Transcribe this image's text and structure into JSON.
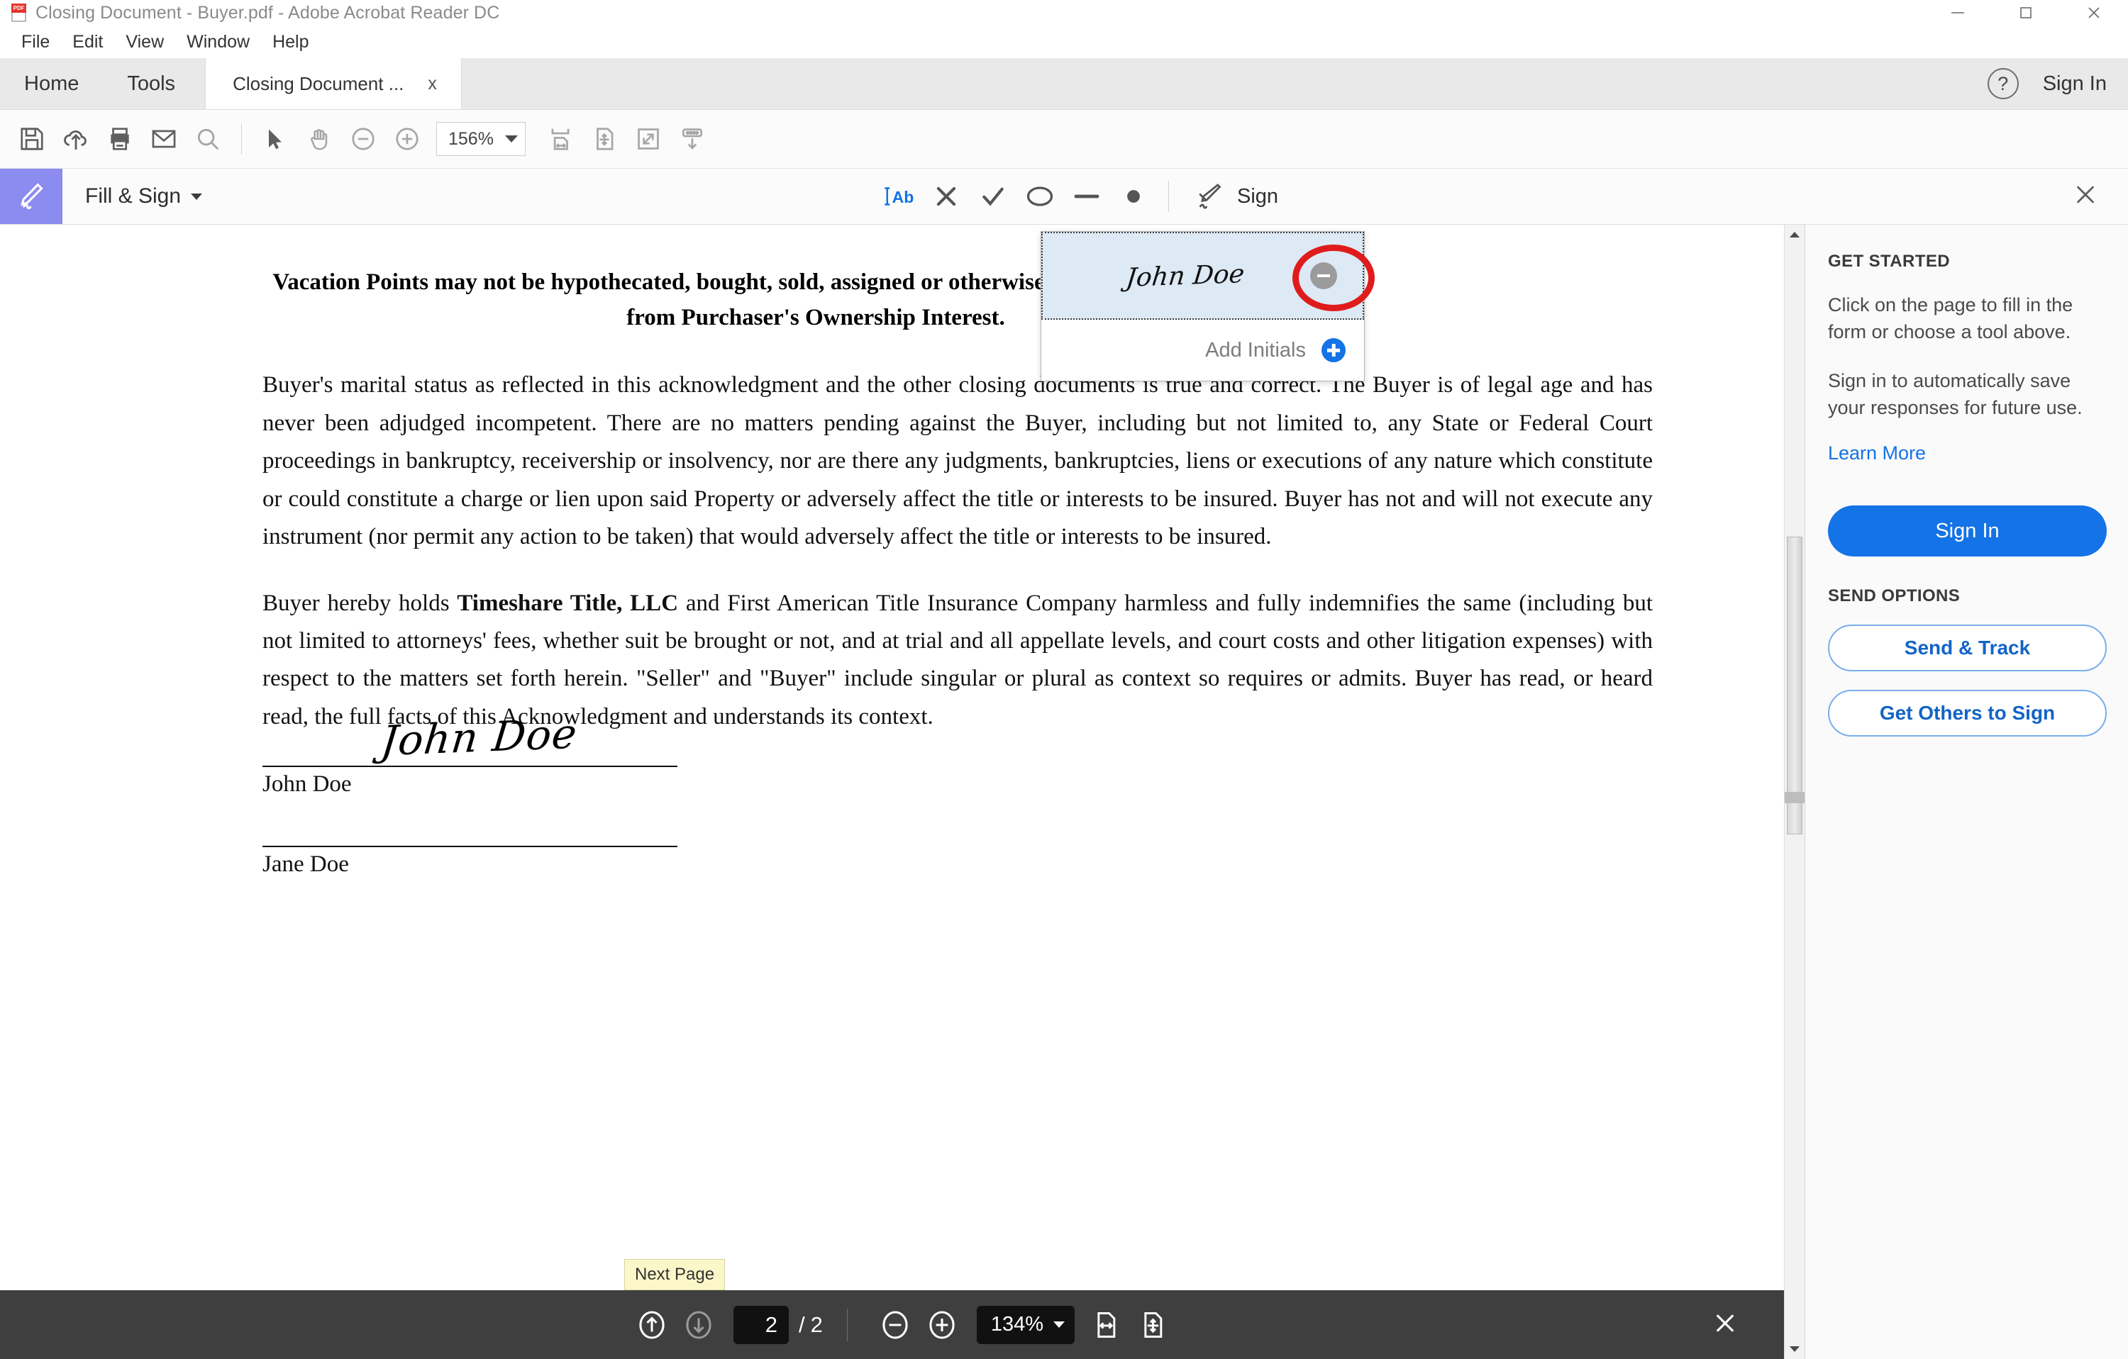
{
  "window": {
    "title": "Closing Document - Buyer.pdf - Adobe Acrobat Reader DC",
    "app_icon": "pdf-file-icon",
    "minimize": "minimize-icon",
    "maximize": "maximize-icon",
    "close": "close-icon"
  },
  "menubar": {
    "items": [
      "File",
      "Edit",
      "View",
      "Window",
      "Help"
    ]
  },
  "tabbar": {
    "home": "Home",
    "tools": "Tools",
    "document_tab": "Closing Document ...",
    "document_tab_close": "x",
    "help_icon": "?",
    "sign_in": "Sign In"
  },
  "toolbar": {
    "icons": [
      "save-icon",
      "upload-to-cloud-icon",
      "print-icon",
      "email-icon",
      "search-icon",
      "select-cursor-icon",
      "hand-tool-icon",
      "zoom-out-icon",
      "zoom-in-icon"
    ],
    "zoom_value": "156%",
    "right_icons": [
      "fit-width-icon",
      "fit-page-icon",
      "fullscreen-icon",
      "scroll-down-icon"
    ]
  },
  "fill_and_sign": {
    "badge_icon": "sign-pen-icon",
    "label": "Fill & Sign",
    "tools": [
      {
        "name": "text-tool",
        "glyph": "Ab",
        "active": true
      },
      {
        "name": "cross-mark-tool",
        "glyph": "X",
        "active": false
      },
      {
        "name": "checkmark-tool",
        "glyph": "check",
        "active": false
      },
      {
        "name": "circle-tool",
        "glyph": "circle",
        "active": false
      },
      {
        "name": "line-tool",
        "glyph": "line",
        "active": false
      },
      {
        "name": "dot-tool",
        "glyph": "dot",
        "active": false
      }
    ],
    "sign_label": "Sign",
    "close_icon": "close-icon"
  },
  "signature_popup": {
    "signature_text": "John Doe",
    "remove_icon": "minus-circle-icon",
    "add_initials_label": "Add Initials",
    "add_icon": "plus-circle-icon",
    "highlight_color": "#dde9f5",
    "annotation_color": "#e01b1b"
  },
  "document": {
    "heading": "Vacation Points may not be hypothecated, bought, sold, assigned or otherwise transferred separate and apart from Purchaser's Ownership Interest.",
    "paragraph_1": "Buyer's marital status as reflected in this acknowledgment and the other closing documents is true and correct. The Buyer is of legal age and has never been adjudged incompetent. There are no matters pending against the Buyer, including but not limited to, any State or Federal Court proceedings in bankruptcy, receivership or insolvency, nor are there any judgments, bankruptcies, liens or executions of any nature which constitute or could constitute a charge or lien upon said Property or adversely affect the title or interests to be insured. Buyer has not and will not execute any instrument (nor permit any action to be taken) that would adversely affect the title or interests to be insured.",
    "paragraph_2_pre": "Buyer hereby holds ",
    "paragraph_2_bold": "Timeshare Title, LLC",
    "paragraph_2_post": " and First American Title Insurance Company harmless and fully indemnifies the same (including but not limited to attorneys' fees, whether suit be brought or not, and at trial and all appellate levels, and court costs and other litigation expenses) with respect to the matters set forth herein. \"Seller\" and \"Buyer\" include singular or plural as context so requires or admits. Buyer has read, or heard read, the full facts of this Acknowledgment and understands its context.",
    "signature_lines": [
      {
        "name": "John Doe",
        "signed_text": "John Doe",
        "signed": true
      },
      {
        "name": "Jane Doe",
        "signed_text": "",
        "signed": false
      }
    ]
  },
  "right_panel": {
    "get_started_heading": "GET STARTED",
    "text_1": "Click on the page to fill in the form or choose a tool above.",
    "text_2": "Sign in to automatically save your responses for future use.",
    "learn_more": "Learn More",
    "sign_in_button": "Sign In",
    "send_options_heading": "SEND OPTIONS",
    "send_and_track": "Send & Track",
    "get_others_to_sign": "Get Others to Sign",
    "accent_color": "#1473e6"
  },
  "bottom_bar": {
    "previous_page_icon": "arrow-up-circle-icon",
    "next_page_icon": "arrow-down-circle-icon",
    "current_page": "2",
    "separator": "/",
    "total_pages": "2",
    "zoom_out_icon": "minus-circle-icon",
    "zoom_in_icon": "plus-circle-icon",
    "zoom_value": "134%",
    "fit_width_icon": "fit-width-icon",
    "fit_page_icon": "fit-page-icon",
    "close_icon": "close-icon",
    "tooltip": "Next Page"
  }
}
